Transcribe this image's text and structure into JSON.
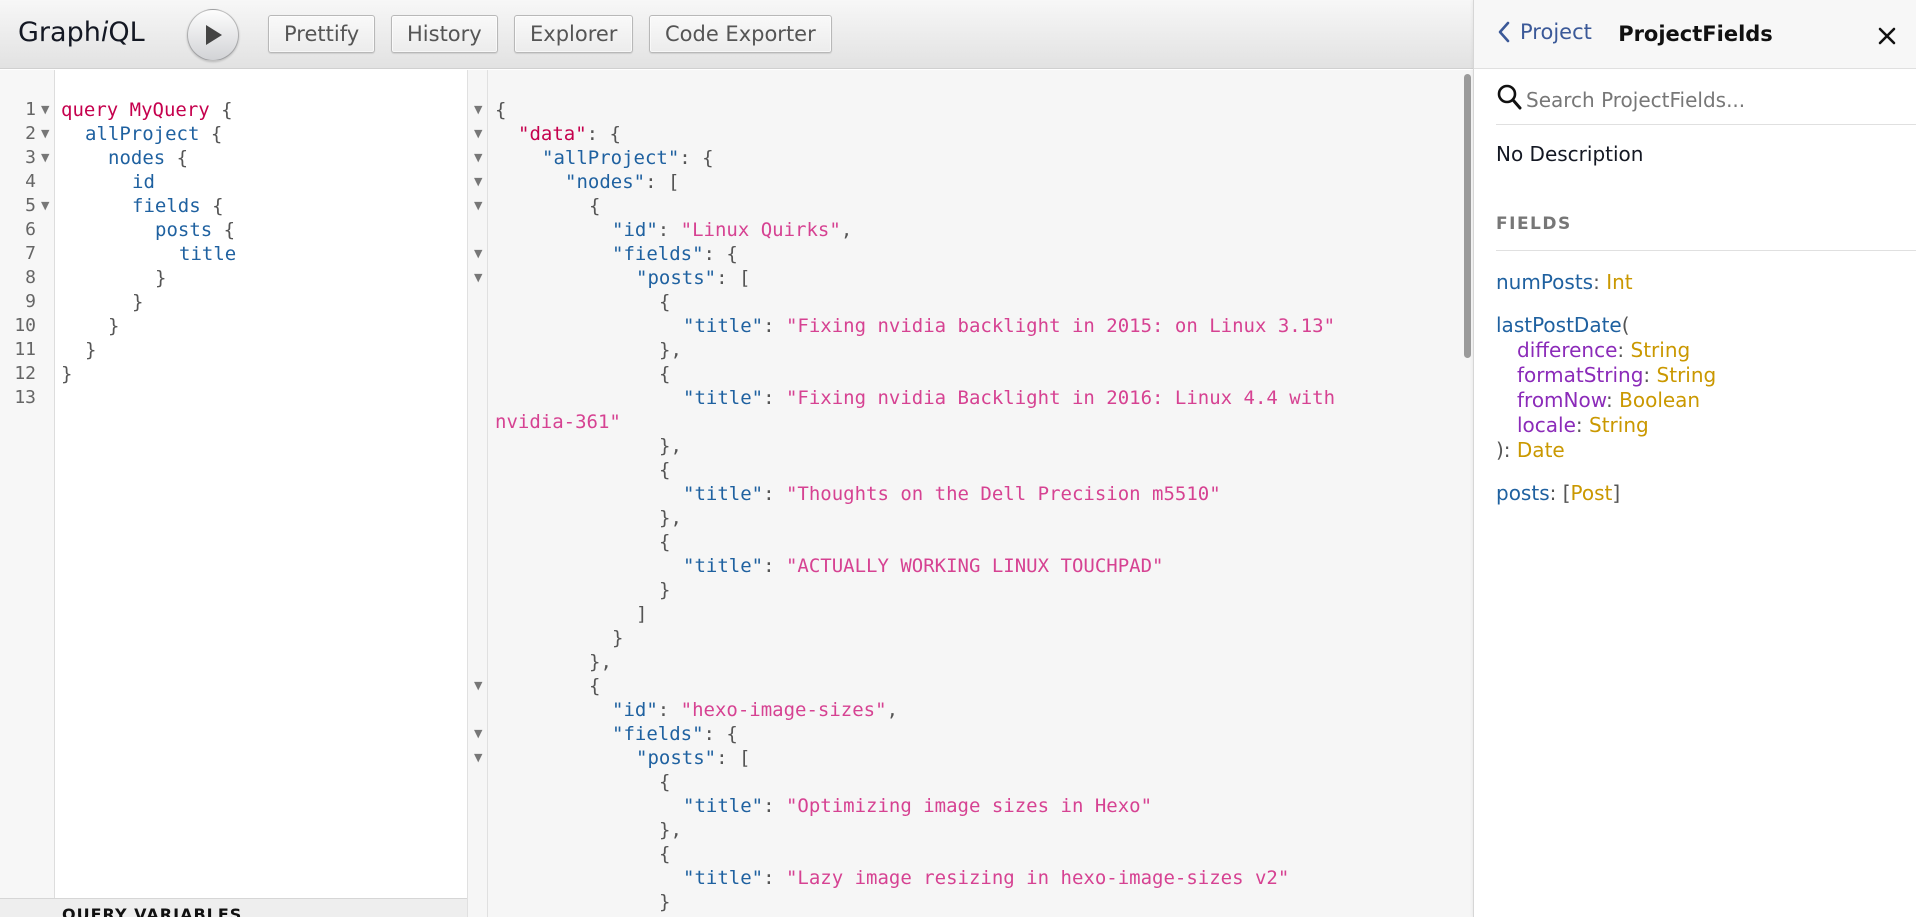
{
  "app": {
    "title_prefix": "Graph",
    "title_italic": "i",
    "title_suffix": "QL"
  },
  "toolbar": {
    "prettify": "Prettify",
    "history": "History",
    "explorer": "Explorer",
    "code_exporter": "Code Exporter"
  },
  "query": {
    "line_numbers": [
      "1",
      "2",
      "3",
      "4",
      "5",
      "6",
      "7",
      "8",
      "9",
      "10",
      "11",
      "12",
      "13"
    ],
    "keyword": "query",
    "operation_name": "MyQuery",
    "l1_brace": " {",
    "l2_field": "allProject",
    "l2_brace": " {",
    "l3_field": "nodes",
    "l3_brace": " {",
    "l4_field": "id",
    "l5_field": "fields",
    "l5_brace": " {",
    "l6_field": "posts",
    "l6_brace": " {",
    "l7_field": "title",
    "close": "}"
  },
  "variables": {
    "header": "QUERY VARIABLES"
  },
  "result": {
    "open_brace": "{",
    "open_bracket": "[",
    "close_brace": "}",
    "close_brace_comma": "},",
    "close_bracket": "]",
    "colon_brace": ": {",
    "colon_bracket": ": [",
    "colon": ": ",
    "comma": ",",
    "key_data": "\"data\"",
    "key_allProject": "\"allProject\"",
    "key_nodes": "\"nodes\"",
    "key_id": "\"id\"",
    "key_fields": "\"fields\"",
    "key_posts": "\"posts\"",
    "key_title": "\"title\"",
    "val_id1": "\"Linux Quirks\"",
    "val_t1": "\"Fixing nvidia backlight in 2015: on Linux 3.13\"",
    "val_t2a": "\"Fixing nvidia Backlight in 2016: Linux 4.4 with",
    "val_t2b": "nvidia-361\"",
    "val_t3": "\"Thoughts on the Dell Precision m5510\"",
    "val_t4": "\"ACTUALLY WORKING LINUX TOUCHPAD\"",
    "val_id2": "\"hexo-image-sizes\"",
    "val_t5": "\"Optimizing image sizes in Hexo\"",
    "val_t6": "\"Lazy image resizing in hexo-image-sizes v2\""
  },
  "docs": {
    "back_label": "Project",
    "title": "ProjectFields",
    "search_placeholder": "Search ProjectFields...",
    "description": "No Description",
    "fields_header": "FIELDS",
    "field1_name": "numPosts",
    "field1_type": "Int",
    "field2_name": "lastPostDate",
    "field2_open": "(",
    "arg1_name": "difference",
    "arg1_type": "String",
    "arg2_name": "formatString",
    "arg2_type": "String",
    "arg3_name": "fromNow",
    "arg3_type": "Boolean",
    "arg4_name": "locale",
    "arg4_type": "String",
    "field2_close": "): ",
    "field2_type": "Date",
    "field3_name": "posts",
    "field3_type": "Post",
    "colon": ": ",
    "lbracket": "[",
    "rbracket": "]"
  },
  "colors": {
    "keyword": "#c5004d",
    "field": "#1f61a0",
    "string": "#d64292",
    "arg": "#8b2bb9",
    "type": "#ca9800",
    "link": "#3b5998"
  }
}
